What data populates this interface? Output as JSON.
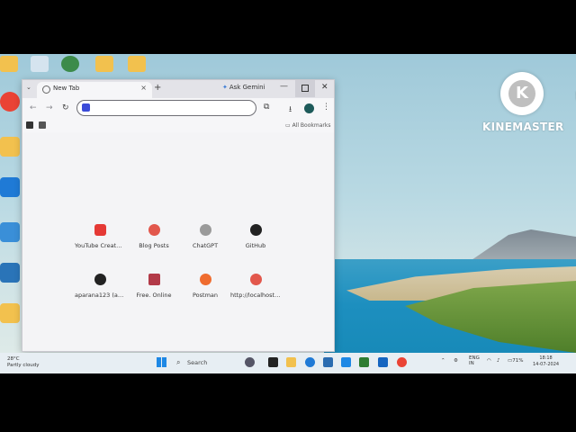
{
  "browser": {
    "tab": {
      "title": "New Tab",
      "close": "×"
    },
    "new_tab_glyph": "+",
    "gemini_label": "Ask Gemini",
    "window_controls": {
      "minimize": "—",
      "close": "✕"
    },
    "nav": {
      "back": "←",
      "forward": "→",
      "reload": "↻"
    },
    "toolbar_glyphs": {
      "extensions": "⧉",
      "download": "⭳",
      "menu": "⋮"
    },
    "bookmarks": {
      "all_label": "All Bookmarks"
    },
    "shortcuts": [
      {
        "label": "YouTube Creato...",
        "icon": "youtube-icon",
        "color": "#e53935"
      },
      {
        "label": "Blog Posts",
        "icon": "letter-l-icon",
        "color": "#e2574c"
      },
      {
        "label": "ChatGPT",
        "icon": "chatgpt-icon",
        "color": "#777777"
      },
      {
        "label": "GitHub",
        "icon": "github-icon",
        "color": "#222222"
      },
      {
        "label": "aparana123 (ap...",
        "icon": "github-icon",
        "color": "#222222"
      },
      {
        "label": "Free. Online",
        "icon": "book-icon",
        "color": "#b23a48"
      },
      {
        "label": "Postman",
        "icon": "postman-icon",
        "color": "#ef6c2f"
      },
      {
        "label": "http://localhost:...",
        "icon": "letter-l-icon",
        "color": "#e2574c"
      }
    ]
  },
  "taskbar": {
    "weather_temp": "28°C",
    "weather_text": "Partly cloudy",
    "search_label": "Search",
    "lang": "ENG",
    "lang_sub": "IN",
    "battery": "71%",
    "time": "18:18",
    "date": "14-07-2024"
  },
  "watermark": {
    "text": "KINEMASTER",
    "letter": "K"
  }
}
